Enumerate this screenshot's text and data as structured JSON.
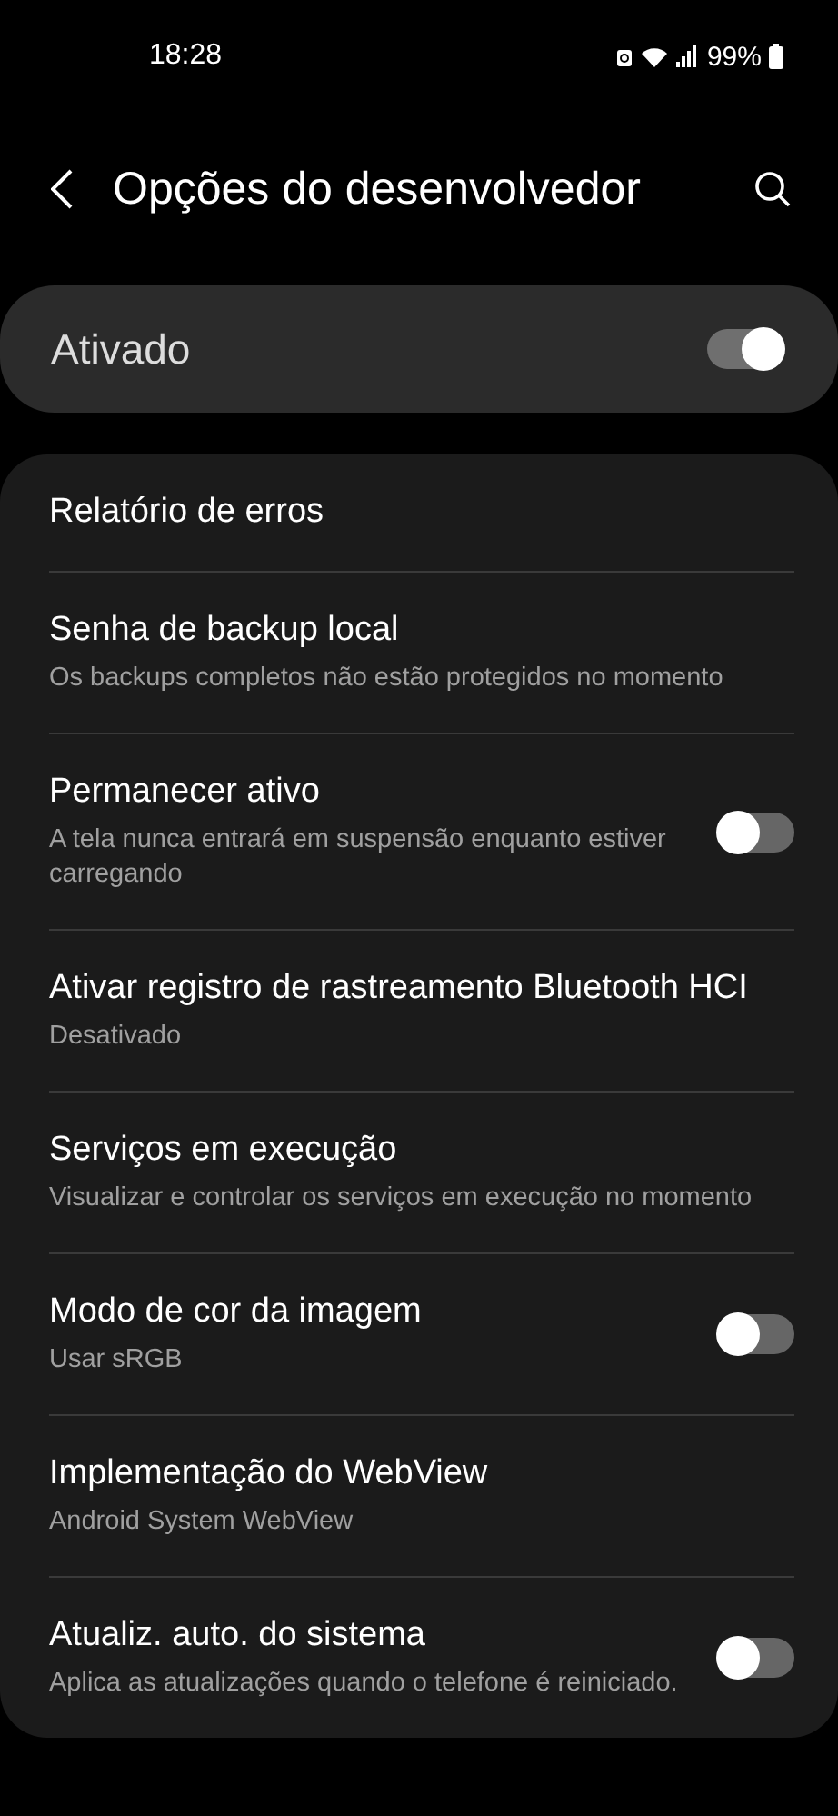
{
  "status_bar": {
    "time": "18:28",
    "battery": "99%"
  },
  "header": {
    "title": "Opções do desenvolvedor"
  },
  "master": {
    "label": "Ativado",
    "on": true
  },
  "items": [
    {
      "kind": "plain",
      "title": "Relatório de erros"
    },
    {
      "kind": "plain",
      "title": "Senha de backup local",
      "subtitle": "Os backups completos não estão protegidos no momento"
    },
    {
      "kind": "toggle",
      "title": "Permanecer ativo",
      "subtitle": "A tela nunca entrará em suspensão enquanto estiver carregando",
      "on": false
    },
    {
      "kind": "plain",
      "title": "Ativar registro de rastreamento Bluetooth HCI",
      "subtitle": "Desativado"
    },
    {
      "kind": "plain",
      "title": "Serviços em execução",
      "subtitle": "Visualizar e controlar os serviços em execução no momento"
    },
    {
      "kind": "toggle",
      "title": "Modo de cor da imagem",
      "subtitle": "Usar sRGB",
      "on": false
    },
    {
      "kind": "plain",
      "title": "Implementação do WebView",
      "subtitle": "Android System WebView"
    },
    {
      "kind": "toggle",
      "title": "Atualiz. auto. do sistema",
      "subtitle": "Aplica as atualizações quando o telefone é reiniciado.",
      "on": false
    }
  ]
}
